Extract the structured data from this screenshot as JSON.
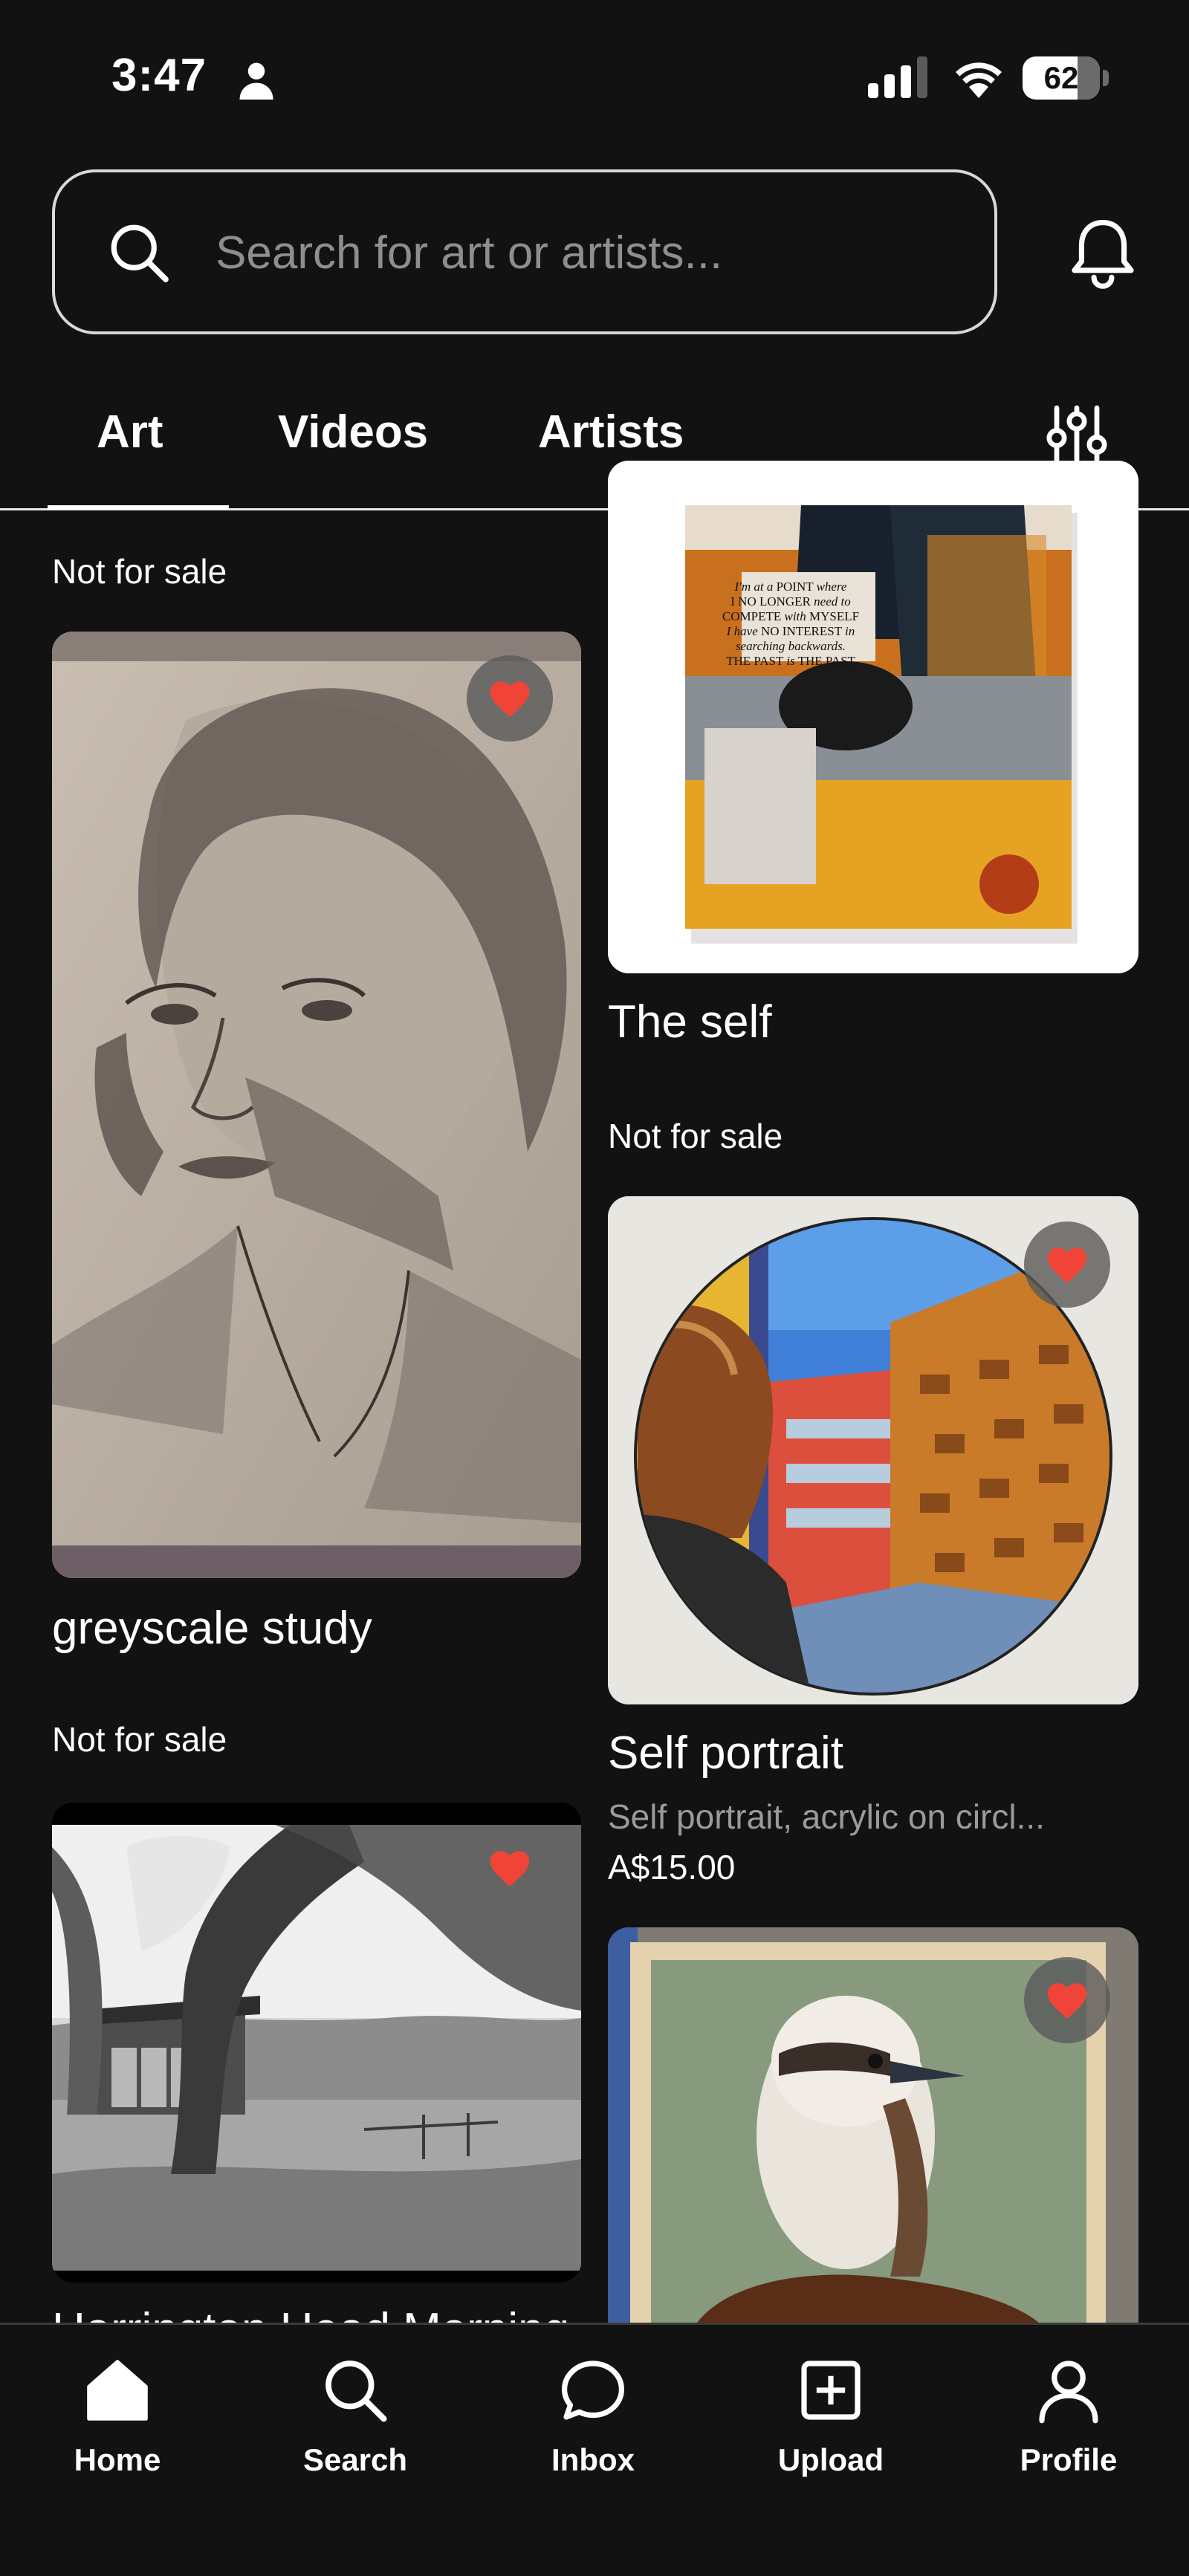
{
  "status_bar": {
    "time": "3:47",
    "battery": "62"
  },
  "search": {
    "placeholder": "Search for art or artists..."
  },
  "tabs": [
    {
      "label": "Art",
      "active": true
    },
    {
      "label": "Videos",
      "active": false
    },
    {
      "label": "Artists",
      "active": false
    }
  ],
  "feed": {
    "left": [
      {
        "status": "Not for sale"
      },
      {
        "title": "greyscale study",
        "favorited": true
      },
      {
        "status": "Not for sale"
      },
      {
        "title": "Harrington Head Morning",
        "favorited": true
      }
    ],
    "right": [
      {
        "title": "The self",
        "status": "Not for sale"
      },
      {
        "title": "Self portrait",
        "description": "Self portrait, acrylic on circl...",
        "price": "A$15.00",
        "favorited": true
      },
      {
        "favorited": true
      }
    ]
  },
  "bottom_nav": [
    {
      "label": "Home",
      "icon": "home-icon"
    },
    {
      "label": "Search",
      "icon": "search-icon"
    },
    {
      "label": "Inbox",
      "icon": "chat-bubble-icon"
    },
    {
      "label": "Upload",
      "icon": "plus-square-icon"
    },
    {
      "label": "Profile",
      "icon": "person-icon"
    }
  ],
  "colors": {
    "background": "#121212",
    "heart": "#f04438",
    "muted_text": "#9a9a9a"
  }
}
